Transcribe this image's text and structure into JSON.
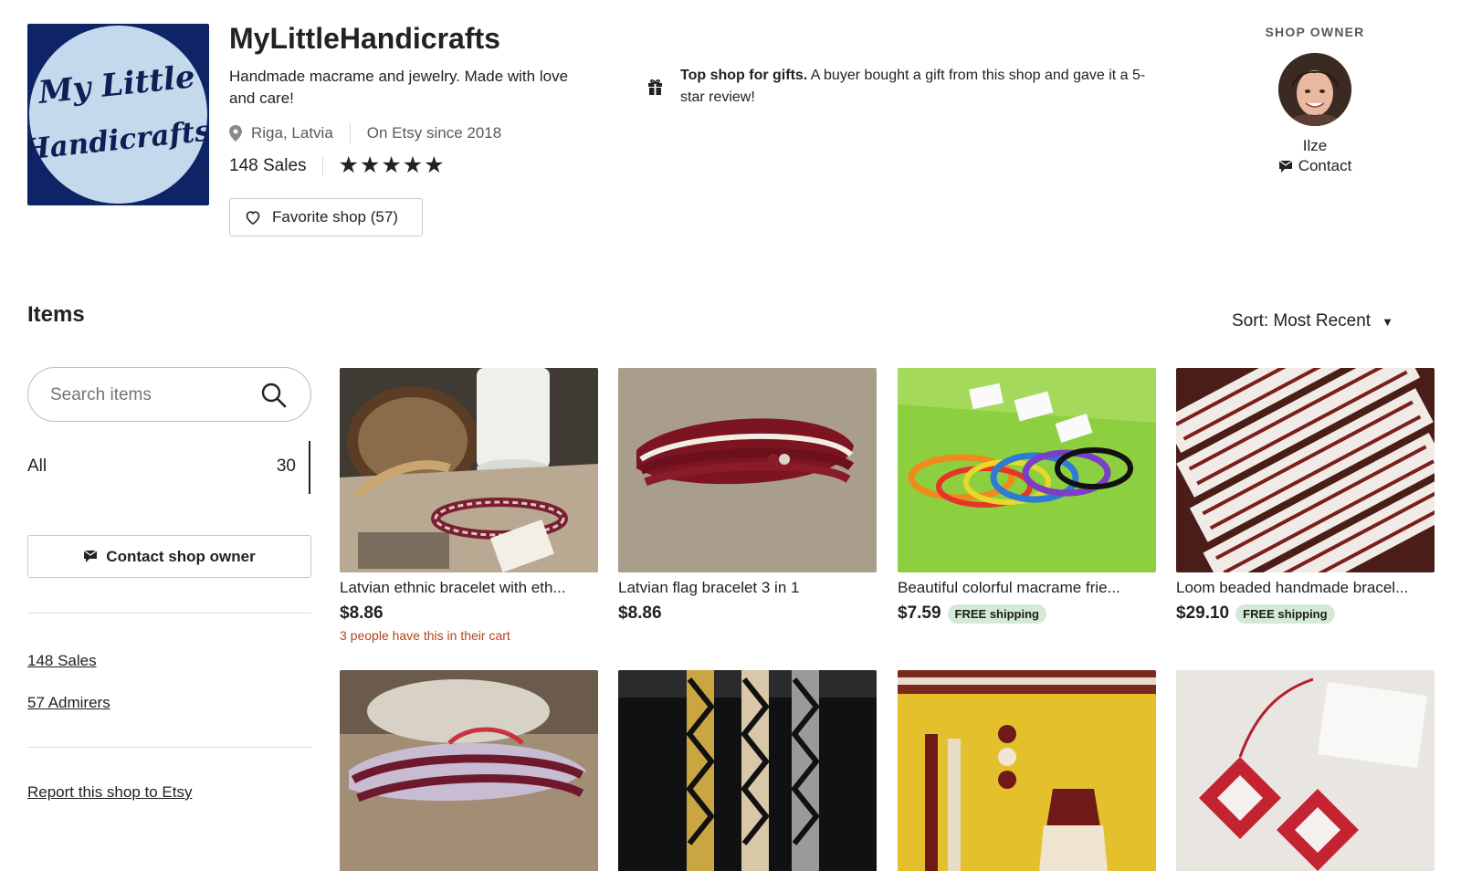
{
  "shop": {
    "logo_line1": "My Little",
    "logo_line2": "Handicrafts",
    "name": "MyLittleHandicrafts",
    "tagline": "Handmade macrame and jewelry. Made with love and care!",
    "location": "Riga, Latvia",
    "since": "On Etsy since 2018",
    "sales": "148 Sales",
    "rating_stars": "★★★★★",
    "favorite_label": "Favorite shop (57)"
  },
  "top_shop": {
    "bold": "Top shop for gifts.",
    "text": " A buyer bought a gift from this shop and gave it a 5-star review!"
  },
  "owner": {
    "label": "SHOP OWNER",
    "name": "Ilze",
    "contact_label": "Contact"
  },
  "items_section": {
    "title": "Items",
    "sort_label": "Sort: Most Recent",
    "search_placeholder": "Search items",
    "category_all": "All",
    "category_all_count": "30",
    "contact_owner_label": "Contact shop owner",
    "sales_link": "148 Sales",
    "admirers_link": "57 Admirers",
    "report_link": "Report this shop to Etsy"
  },
  "listings": [
    {
      "title": "Latvian ethnic bracelet with eth...",
      "price": "$8.86",
      "badge": "",
      "note": "3 people have this in their cart",
      "thumbnail": "maroon-white-woven-bracelet-with-bread-and-milk"
    },
    {
      "title": "Latvian flag bracelet 3 in 1",
      "price": "$8.86",
      "badge": "",
      "note": "",
      "thumbnail": "carmine-white-carmine-macrame-bracelets"
    },
    {
      "title": "Beautiful colorful macrame frie...",
      "price": "$7.59",
      "badge": "FREE shipping",
      "note": "",
      "thumbnail": "rainbow-macrame-bracelets-on-green"
    },
    {
      "title": "Loom beaded handmade bracel...",
      "price": "$29.10",
      "badge": "FREE shipping",
      "note": "",
      "thumbnail": "loom-beaded-bracelets-red-white-pattern"
    },
    {
      "title": "",
      "price": "",
      "badge": "",
      "note": "",
      "thumbnail": "woven-purple-bracelets"
    },
    {
      "title": "",
      "price": "",
      "badge": "",
      "note": "",
      "thumbnail": "beaded-bracelets-gold-beige-silver"
    },
    {
      "title": "",
      "price": "",
      "badge": "",
      "note": "",
      "thumbnail": "beaded-fringe-earrings-on-yellow"
    },
    {
      "title": "",
      "price": "",
      "badge": "",
      "note": "",
      "thumbnail": "red-white-diamond-earrings"
    }
  ],
  "icons": {
    "location": "location-pin-icon",
    "heart": "heart-icon",
    "gift": "gift-icon",
    "mail": "mail-icon",
    "search": "search-icon",
    "caret": "caret-down-icon"
  },
  "colors": {
    "logo_bg": "#0e2466",
    "logo_circle": "#c4d9ec",
    "badge_bg": "#d4e9d7",
    "cart_note": "#b3431f"
  }
}
